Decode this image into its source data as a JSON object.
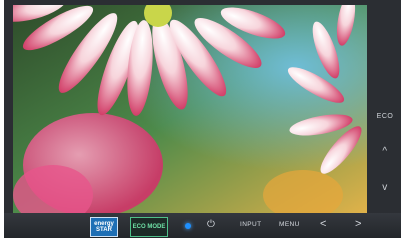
{
  "side_controls": {
    "eco": "ECO",
    "up": "^",
    "down": "v"
  },
  "bottom_controls": {
    "energy_star_badge": "energy STAR",
    "eco_mode_badge": "ECO MODE",
    "power_icon": "⏻",
    "input": "INPUT",
    "menu": "MENU",
    "left": "<",
    "right": ">"
  },
  "colors": {
    "bezel": "#2b2e33",
    "power_led": "#1e90ff"
  }
}
